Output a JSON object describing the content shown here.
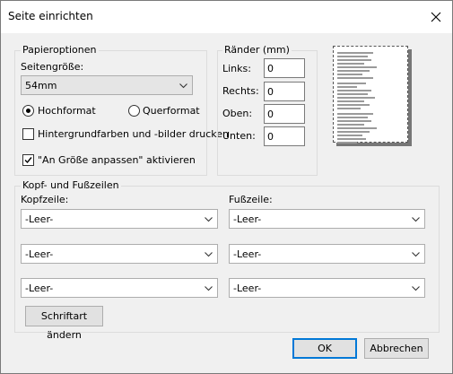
{
  "window": {
    "title": "Seite einrichten"
  },
  "paper_options": {
    "legend": "Papieroptionen",
    "size_label": "Seitengröße:",
    "size_value": "54mm",
    "portrait_label": "Hochformat",
    "landscape_label": "Querformat",
    "portrait_selected": true,
    "print_background_label": "Hintergrundfarben und -bilder drucken",
    "print_background_checked": false,
    "shrink_label": "\"An Größe anpassen\" aktivieren",
    "shrink_checked": true
  },
  "margins": {
    "legend": "Ränder (mm)",
    "left_label": "Links:",
    "left_value": "0",
    "right_label": "Rechts:",
    "right_value": "0",
    "top_label": "Oben:",
    "top_value": "0",
    "bottom_label": "Unten:",
    "bottom_value": "0"
  },
  "headers_footers": {
    "legend": "Kopf- und Fußzeilen",
    "header_label": "Kopfzeile:",
    "footer_label": "Fußzeile:",
    "header_values": [
      "-Leer-",
      "-Leer-",
      "-Leer-"
    ],
    "footer_values": [
      "-Leer-",
      "-Leer-",
      "-Leer-"
    ],
    "change_font_label": "Schriftart ändern"
  },
  "buttons": {
    "ok": "OK",
    "cancel": "Abbrechen"
  },
  "icons": {
    "close": "close-icon",
    "dropdown": "chevron-down-icon"
  }
}
